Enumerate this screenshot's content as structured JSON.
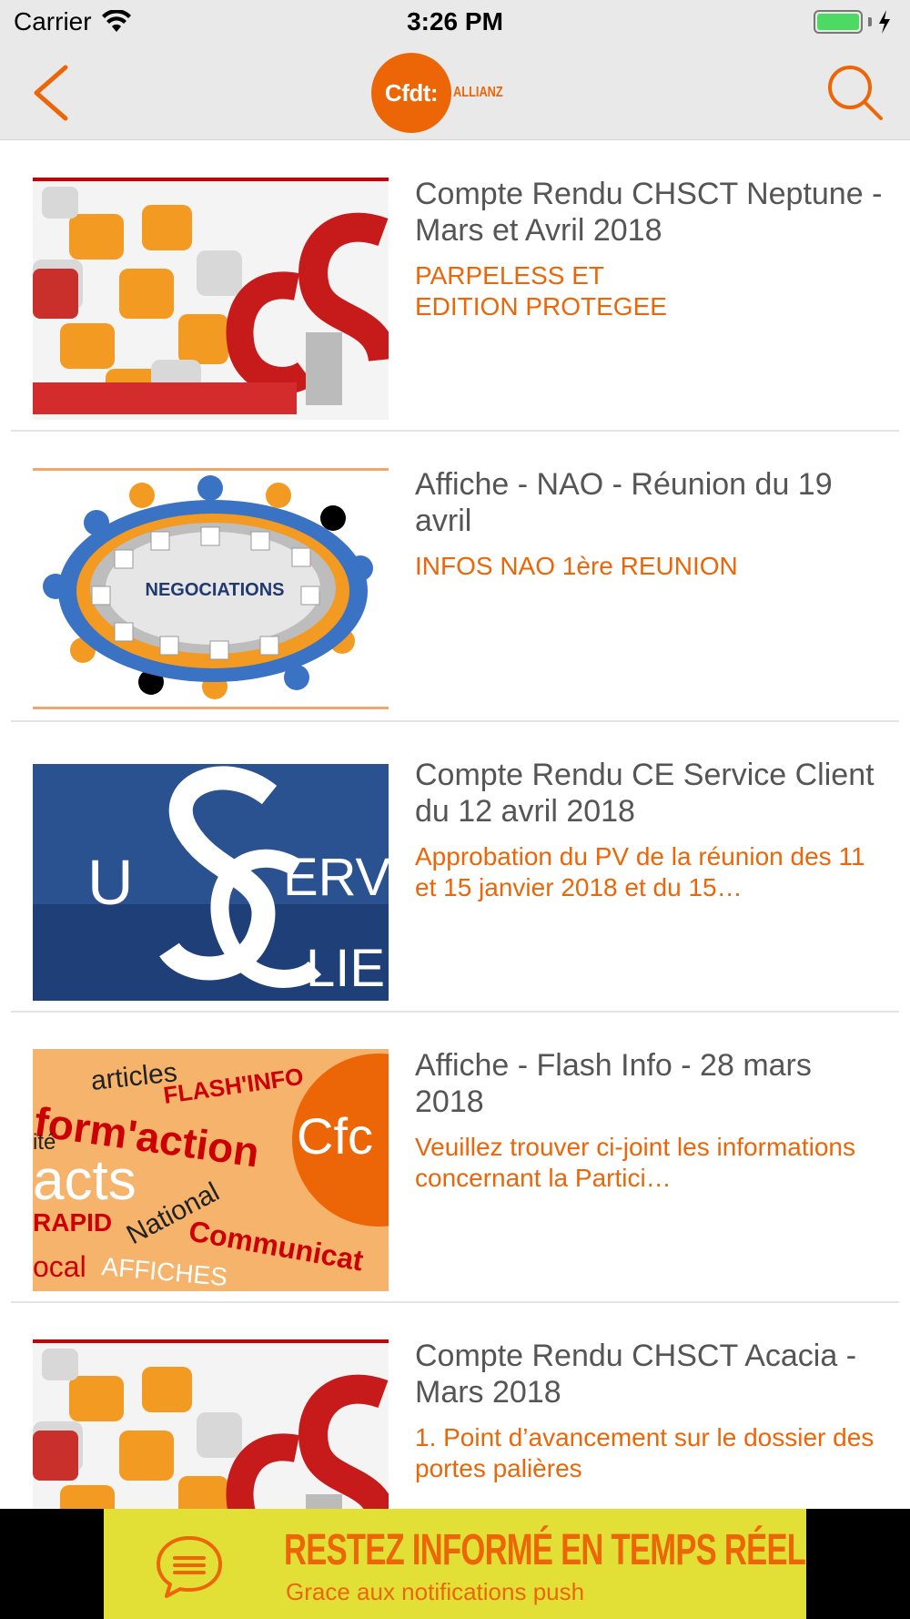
{
  "status_bar": {
    "carrier": "Carrier",
    "time": "3:26 PM"
  },
  "nav": {
    "logo_text": "Cfdt:",
    "logo_sub": "ALLIANZ",
    "back_icon": "chevron-left-icon",
    "search_icon": "search-icon"
  },
  "colors": {
    "accent": "#ec6608",
    "title_text": "#555555",
    "bar_bg": "#e9e9e9",
    "banner_bg": "#e2e037"
  },
  "items": [
    {
      "title": "Compte Rendu CHSCT Neptune - Mars et Avril 2018",
      "subtitle": "PARPELESS ET\nEDITION PROTEGEE",
      "image": "chsct-puzzle"
    },
    {
      "title": "Affiche - NAO - Réunion du 19 avril",
      "subtitle": "INFOS NAO 1ère REUNION",
      "image": "negociations",
      "image_text": "NEGOCIATIONS"
    },
    {
      "title": "Compte Rendu CE Service Client du 12 avril 2018",
      "subtitle": "Approbation du PV de la réunion des 11 et 15 janvier 2018 et du 15…",
      "image": "service-client",
      "image_text": [
        "U",
        "ERVI",
        "LIE"
      ]
    },
    {
      "title": "Affiche - Flash Info - 28 mars 2018",
      "subtitle": "Veuillez trouver ci-joint les informations concernant la Partici…",
      "image": "flash-info",
      "image_text": [
        "articles",
        "FLASH'INFO",
        "form'action",
        "ité",
        "acts",
        "National",
        "RAPID",
        "Communicat",
        "ocal",
        "AFFICHES",
        "Cfc"
      ]
    },
    {
      "title": "Compte Rendu CHSCT Acacia - Mars 2018",
      "subtitle": "1. Point d’avancement sur le dossier des portes palières",
      "image": "chsct-puzzle"
    }
  ],
  "banner": {
    "title": "RESTEZ INFORMÉ EN TEMPS RÉEL",
    "subtitle": "Grace aux notifications push",
    "icon": "chat-bubble-icon"
  }
}
